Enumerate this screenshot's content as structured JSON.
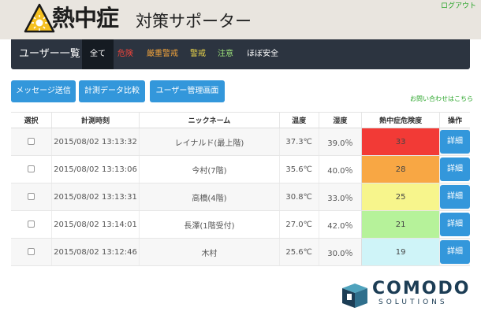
{
  "header": {
    "title": "熱中症",
    "subtitle": "対策サポーター",
    "logout": "ログアウト"
  },
  "nav": {
    "brand": "ユーザー一覧",
    "items": [
      {
        "label": "全て",
        "color": "#ffffff",
        "active": true
      },
      {
        "label": "危険",
        "color": "#e8433a"
      },
      {
        "label": "厳重警戒",
        "color": "#f3a43b"
      },
      {
        "label": "警戒",
        "color": "#f0d94a"
      },
      {
        "label": "注意",
        "color": "#9be07a"
      },
      {
        "label": "ほぼ安全",
        "color": "#ffffff"
      }
    ]
  },
  "toolbar": {
    "send_message": "メッセージ送信",
    "compare": "計測データ比較",
    "user_admin": "ユーザー管理画面",
    "contact": "お問い合わせはこちら"
  },
  "table": {
    "headers": [
      "選択",
      "計測時刻",
      "ニックネーム",
      "温度",
      "湿度",
      "熱中症危険度",
      "操作"
    ],
    "detail_label": "詳細",
    "rows": [
      {
        "time": "2015/08/02 13:13:32",
        "name": "レイナルド(最上階)",
        "temp": "37.3℃",
        "hum": "39.0％",
        "risk": "33",
        "risk_color": "#f23a36"
      },
      {
        "time": "2015/08/02 13:13:06",
        "name": "今村(7階)",
        "temp": "35.6℃",
        "hum": "40.0％",
        "risk": "28",
        "risk_color": "#f8a744"
      },
      {
        "time": "2015/08/02 13:13:31",
        "name": "高橋(4階)",
        "temp": "30.8℃",
        "hum": "33.0％",
        "risk": "25",
        "risk_color": "#f7f58c"
      },
      {
        "time": "2015/08/02 13:14:01",
        "name": "長澤(1階受付)",
        "temp": "27.0℃",
        "hum": "42.0％",
        "risk": "21",
        "risk_color": "#b6f29a"
      },
      {
        "time": "2015/08/02 13:12:46",
        "name": "木村",
        "temp": "25.6℃",
        "hum": "30.0％",
        "risk": "19",
        "risk_color": "#cff4f8"
      }
    ]
  },
  "footer": {
    "brand": "COMODO",
    "brand_sub": "SOLUTIONS"
  }
}
